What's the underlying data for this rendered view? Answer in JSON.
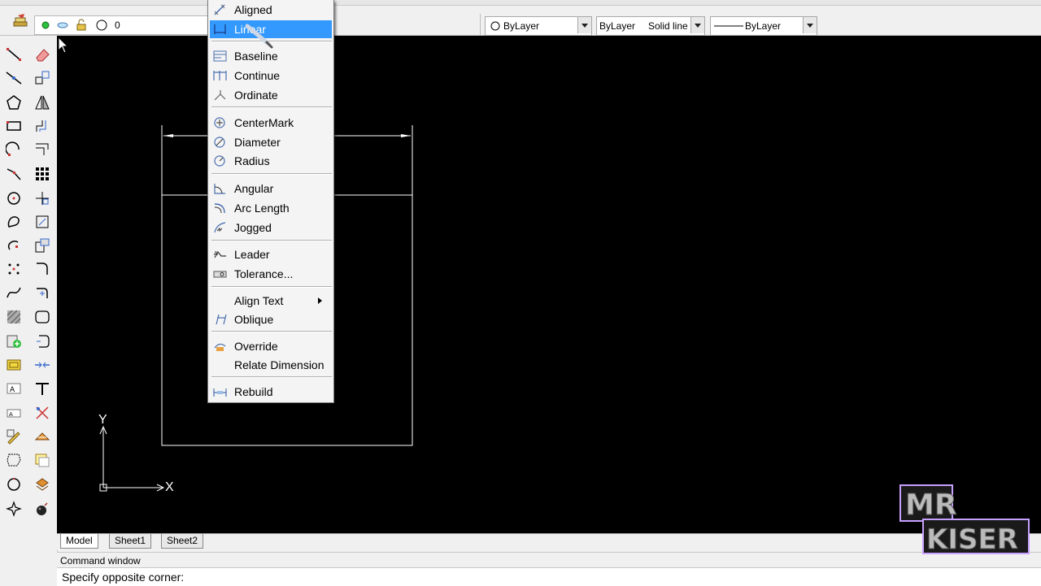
{
  "toolbar": {
    "layer_name": "0",
    "color_value": "ByLayer",
    "linetype_value": "ByLayer",
    "linetype_desc": "Solid line",
    "lineweight_value": "ByLayer"
  },
  "dimension_menu": {
    "items": [
      {
        "label": "Aligned",
        "icon": "aligned-dim-icon"
      },
      {
        "label": "Linear",
        "icon": "linear-dim-icon",
        "highlighted": true
      },
      {
        "label": "Baseline",
        "icon": "baseline-dim-icon"
      },
      {
        "label": "Continue",
        "icon": "continue-dim-icon"
      },
      {
        "label": "Ordinate",
        "icon": "ordinate-dim-icon"
      },
      {
        "label": "CenterMark",
        "icon": "centermark-icon"
      },
      {
        "label": "Diameter",
        "icon": "diameter-icon"
      },
      {
        "label": "Radius",
        "icon": "radius-icon"
      },
      {
        "label": "Angular",
        "icon": "angular-icon"
      },
      {
        "label": "Arc Length",
        "icon": "arc-length-icon"
      },
      {
        "label": "Jogged",
        "icon": "jogged-icon"
      },
      {
        "label": "Leader",
        "icon": "leader-icon"
      },
      {
        "label": "Tolerance...",
        "icon": "tolerance-icon"
      },
      {
        "label": "Align Text",
        "icon": "",
        "submenu": true
      },
      {
        "label": "Oblique",
        "icon": "oblique-icon"
      },
      {
        "label": "Override",
        "icon": "override-icon"
      },
      {
        "label": "Relate Dimension",
        "icon": ""
      },
      {
        "label": "Rebuild",
        "icon": "rebuild-icon"
      }
    ]
  },
  "ucs": {
    "x_label": "X",
    "y_label": "Y"
  },
  "tabs": [
    "Model",
    "Sheet1",
    "Sheet2"
  ],
  "command": {
    "title": "Command window",
    "prompt": "Specify opposite corner:"
  },
  "watermark": {
    "line1": "MR",
    "line2": "KISER"
  },
  "colors": {
    "canvas": "#000000",
    "highlight": "#3399ff",
    "drawing_lines": "#ffffff"
  }
}
